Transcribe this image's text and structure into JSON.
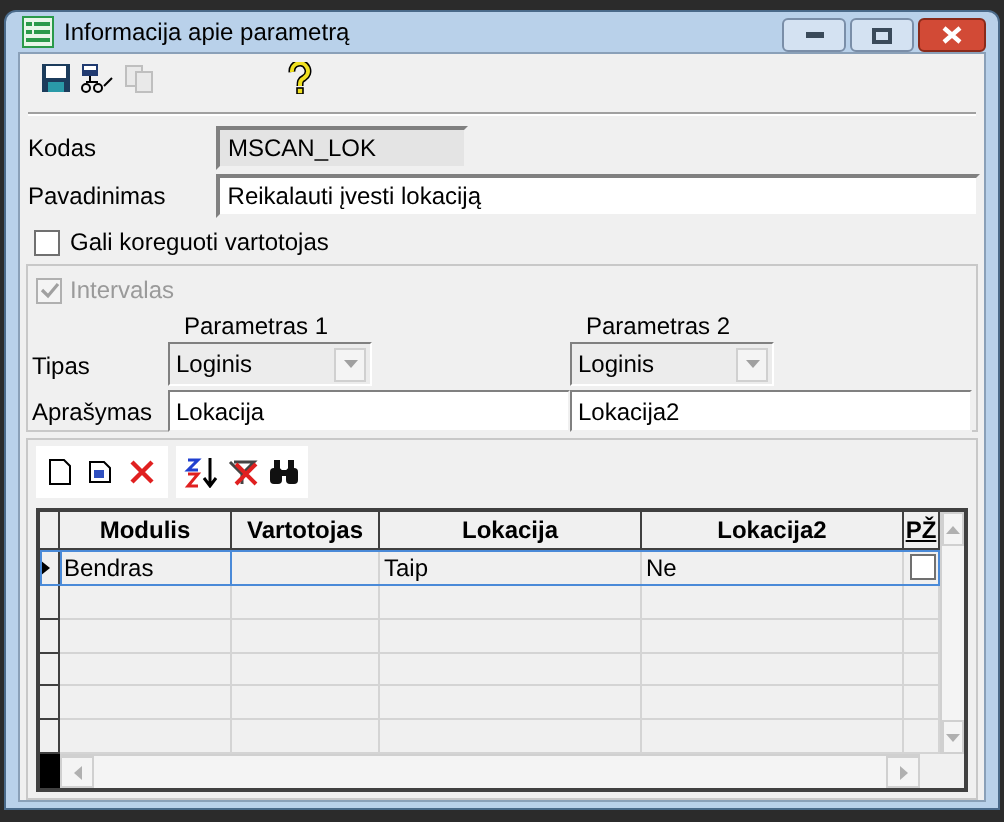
{
  "window": {
    "title": "Informacija apie parametrą"
  },
  "toolbar": [
    {
      "kind": "save",
      "disabled": false
    },
    {
      "kind": "tree",
      "disabled": false
    },
    {
      "kind": "copy",
      "disabled": true
    },
    {
      "kind": "help",
      "disabled": false
    }
  ],
  "fields": [
    {
      "label": "Kodas",
      "value": "MSCAN_LOK",
      "readonly": true
    },
    {
      "label": "Pavadinimas",
      "value": "Reikalauti įvesti lokaciją",
      "readonly": false
    }
  ],
  "user_editable": {
    "label": "Gali koreguoti vartotojas",
    "checked": false
  },
  "interval": {
    "label": "Intervalas",
    "checked": true,
    "disabled": true,
    "tipas_label": "Tipas",
    "aprasymas_label": "Aprašymas",
    "parameters": [
      {
        "heading": "Parametras 1",
        "tipas": "Loginis",
        "aprasymas": "Lokacija"
      },
      {
        "heading": "Parametras 2",
        "tipas": "Loginis",
        "aprasymas": "Lokacija2"
      }
    ]
  },
  "grid_toolbar": [
    {
      "kind": "new"
    },
    {
      "kind": "edit"
    },
    {
      "kind": "delete"
    },
    {
      "kind": "sort"
    },
    {
      "kind": "clear"
    },
    {
      "kind": "find"
    }
  ],
  "table": {
    "columns": [
      "Modulis",
      "Vartotojas",
      "Lokacija",
      "Lokacija2",
      "PŽ"
    ],
    "rows": [
      {
        "cells": [
          "Bendras",
          "",
          "Taip",
          "Ne"
        ],
        "checked": false,
        "selected": true
      }
    ]
  }
}
